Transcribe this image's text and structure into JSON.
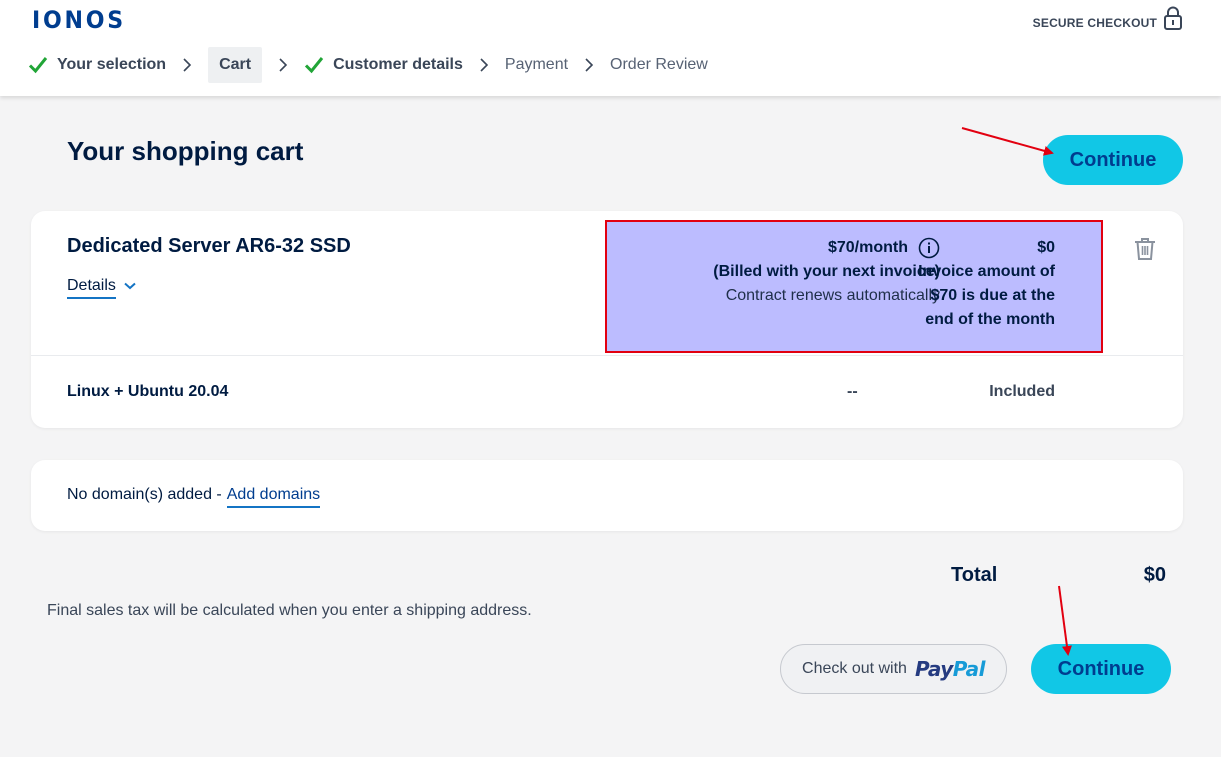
{
  "header": {
    "logo": "IONOS",
    "secure_checkout": "SECURE CHECKOUT"
  },
  "steps": [
    {
      "label": "Your selection",
      "state": "done"
    },
    {
      "label": "Cart",
      "state": "current"
    },
    {
      "label": "Customer details",
      "state": "done"
    },
    {
      "label": "Payment",
      "state": "todo"
    },
    {
      "label": "Order Review",
      "state": "todo"
    }
  ],
  "page": {
    "title": "Your shopping cart",
    "continue_label": "Continue"
  },
  "cart_item": {
    "name": "Dedicated Server AR6-32 SSD",
    "details_label": "Details",
    "price": "$70/month",
    "billed_note": "(Billed with your next invoice)",
    "renew_note": "Contract renews automatically",
    "due_now": "$0",
    "invoice_lines": [
      "Invoice amount of",
      "$70 is due at the",
      "end of the month"
    ],
    "addon": {
      "name": "Linux + Ubuntu 20.04",
      "monthly": "--",
      "price": "Included"
    }
  },
  "domains": {
    "text": "No domain(s) added -",
    "link": "Add domains"
  },
  "summary": {
    "total_label": "Total",
    "total_value": "$0",
    "tax_note": "Final sales tax will be calculated when you enter a shipping address."
  },
  "paypal": {
    "label": "Check out with",
    "logo_pay": "Pay",
    "logo_pal": "Pal"
  },
  "colors": {
    "accent": "#11c7e6",
    "brand": "#003d8f",
    "highlight_fill": "#bcbcff",
    "highlight_border": "#e20010",
    "check_green": "#21a537"
  }
}
